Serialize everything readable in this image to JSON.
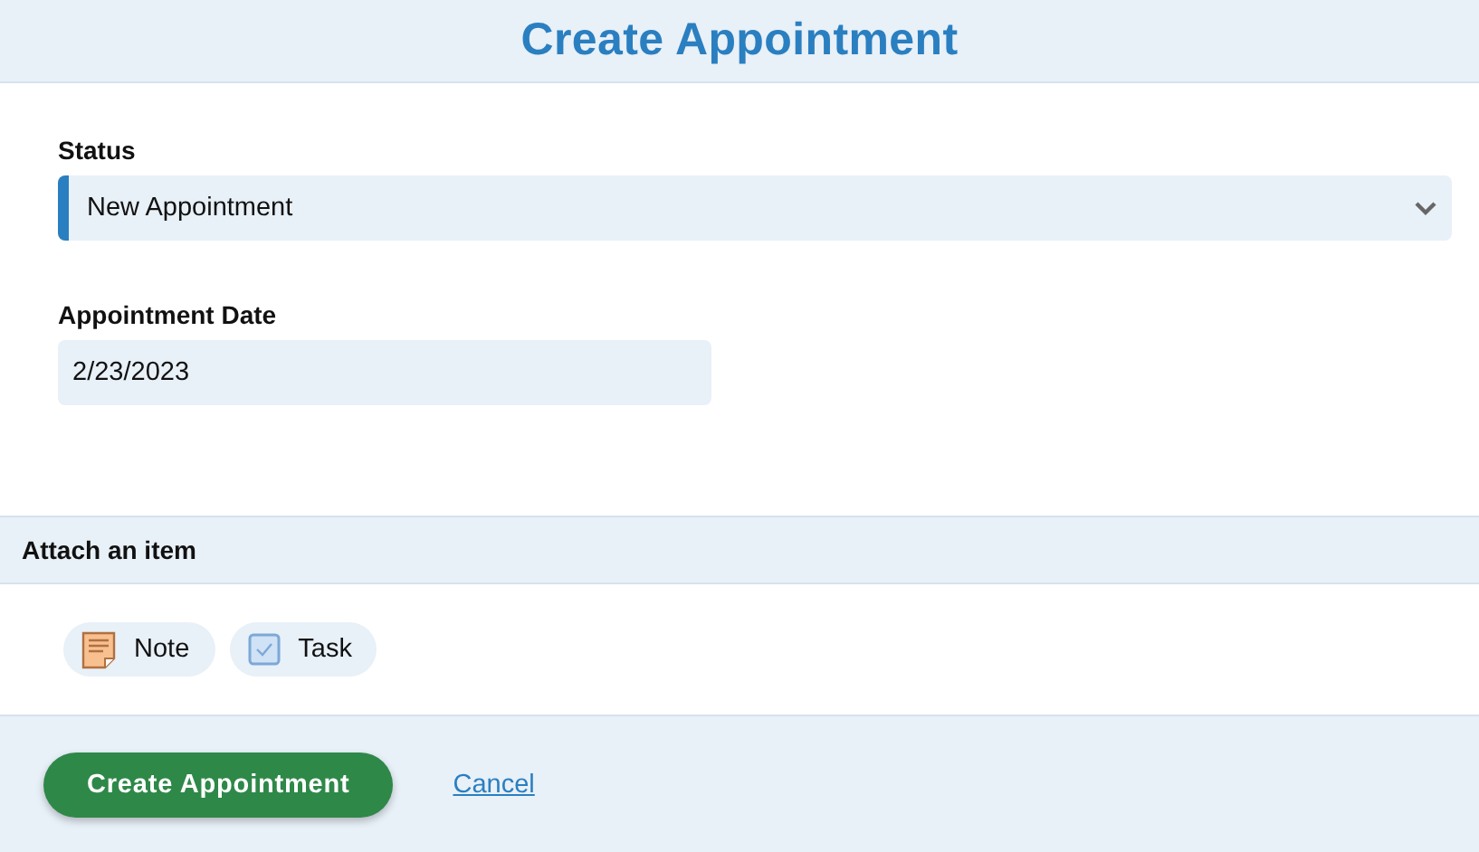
{
  "title": "Create Appointment",
  "fields": [
    {
      "kind": "select",
      "label": "Status",
      "value": "New Appointment"
    },
    {
      "kind": "date",
      "label": "Appointment Date",
      "value": "2/23/2023"
    }
  ],
  "attach": {
    "heading": "Attach an item",
    "items": [
      {
        "kind": "note",
        "label": "Note"
      },
      {
        "kind": "task",
        "label": "Task"
      }
    ]
  },
  "footer": {
    "submit": "Create Appointment",
    "cancel": "Cancel"
  }
}
